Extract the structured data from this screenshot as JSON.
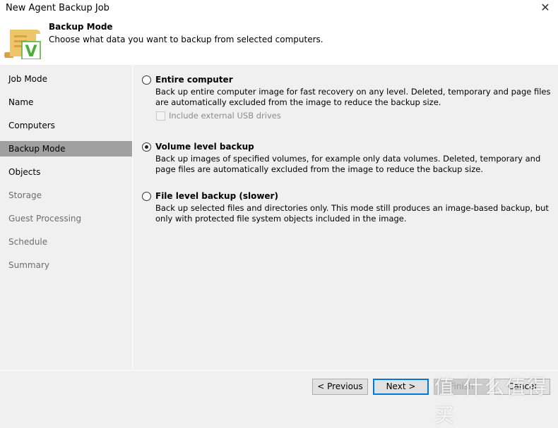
{
  "window": {
    "title": "New Agent Backup Job",
    "close_icon": "close-icon"
  },
  "header": {
    "title": "Backup Mode",
    "subtitle": "Choose what data you want to backup from selected computers.",
    "icon": "scroll-with-v-icon",
    "icon_letter": "V"
  },
  "sidebar": {
    "items": [
      {
        "label": "Job Mode",
        "state": "enabled"
      },
      {
        "label": "Name",
        "state": "enabled"
      },
      {
        "label": "Computers",
        "state": "enabled"
      },
      {
        "label": "Backup Mode",
        "state": "selected"
      },
      {
        "label": "Objects",
        "state": "enabled"
      },
      {
        "label": "Storage",
        "state": "disabled"
      },
      {
        "label": "Guest Processing",
        "state": "disabled"
      },
      {
        "label": "Schedule",
        "state": "disabled"
      },
      {
        "label": "Summary",
        "state": "disabled"
      }
    ]
  },
  "options": [
    {
      "label": "Entire computer",
      "selected": false,
      "description": "Back up entire computer image for fast recovery on any level. Deleted, temporary and page files are automatically excluded from the image to reduce the backup size.",
      "checkbox": {
        "label": "Include external USB drives",
        "checked": false,
        "enabled": false
      }
    },
    {
      "label": "Volume level backup",
      "selected": true,
      "description": "Back up images of specified volumes, for example only data volumes. Deleted, temporary and page files are automatically excluded from the image to reduce the backup size."
    },
    {
      "label": "File level backup (slower)",
      "selected": false,
      "description": "Back up selected files and directories only. This mode still produces an image-based backup, but only with protected file system objects included in the image."
    }
  ],
  "buttons": {
    "previous": "< Previous",
    "next": "Next >",
    "finish": "Finish",
    "cancel": "Cancel"
  },
  "watermark": "值 什么值得买",
  "colors": {
    "selected_nav": "#a0a0a0",
    "primary_border": "#0078d7",
    "icon_gold": "#e8b64c",
    "icon_green": "#4caf35"
  }
}
